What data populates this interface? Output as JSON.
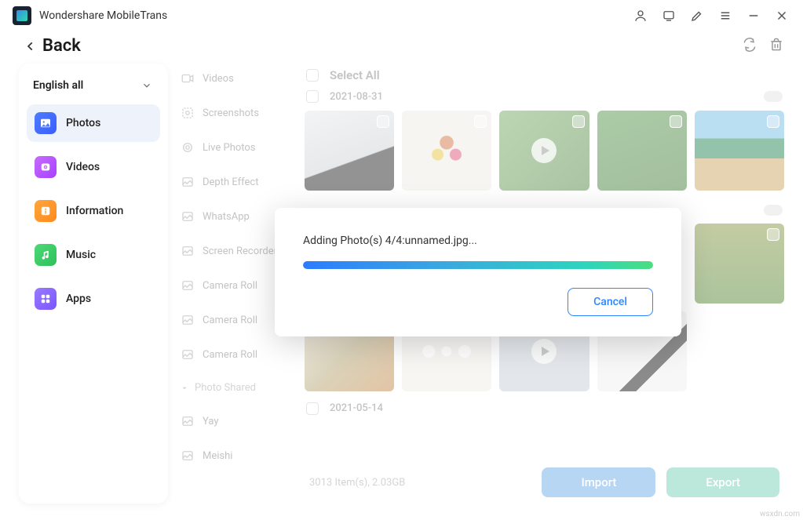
{
  "app": {
    "title": "Wondershare MobileTrans"
  },
  "back": {
    "label": "Back"
  },
  "sidebar": {
    "dropdown": "English all",
    "items": [
      {
        "label": "Photos"
      },
      {
        "label": "Videos"
      },
      {
        "label": "Information"
      },
      {
        "label": "Music"
      },
      {
        "label": "Apps"
      }
    ]
  },
  "categories": {
    "items": [
      {
        "label": "Videos"
      },
      {
        "label": "Screenshots"
      },
      {
        "label": "Live Photos"
      },
      {
        "label": "Depth Effect"
      },
      {
        "label": "WhatsApp"
      },
      {
        "label": "Screen Recorder"
      },
      {
        "label": "Camera Roll"
      },
      {
        "label": "Camera Roll"
      },
      {
        "label": "Camera Roll"
      }
    ],
    "divider": "Photo Shared",
    "more": [
      {
        "label": "Yay"
      },
      {
        "label": "Meishi"
      }
    ]
  },
  "content": {
    "select_all": "Select All",
    "dates": [
      "2021-08-31",
      "2021-05-14"
    ],
    "stats": "3013 Item(s), 2.03GB",
    "import_label": "Import",
    "export_label": "Export"
  },
  "modal": {
    "text": "Adding Photo(s) 4/4:unnamed.jpg...",
    "cancel": "Cancel"
  },
  "watermark": "wsxdn.com"
}
